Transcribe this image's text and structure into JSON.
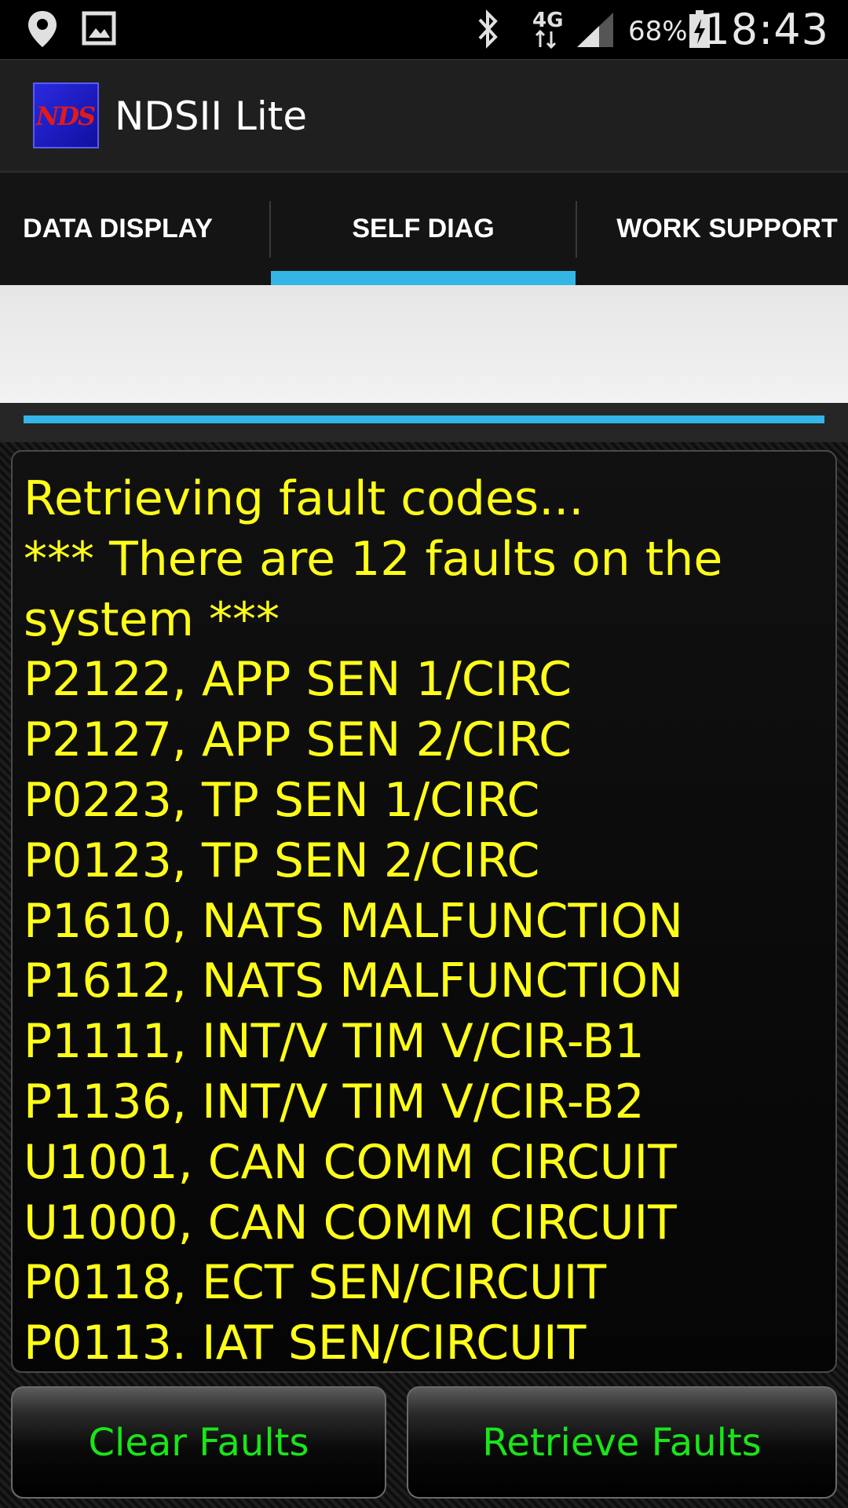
{
  "status_bar": {
    "time": "18:43",
    "battery_percent": "68%",
    "network_type": "4G",
    "icons": [
      "location-pin-icon",
      "image-icon",
      "bluetooth-icon",
      "network-4g-icon",
      "signal-icon",
      "battery-charging-icon"
    ]
  },
  "app": {
    "title": "NDSII Lite",
    "logo_text": "NDS"
  },
  "tabs": [
    {
      "label": "DATA DISPLAY",
      "selected": false
    },
    {
      "label": "SELF DIAG",
      "selected": true
    },
    {
      "label": "WORK SUPPORT",
      "selected": false
    }
  ],
  "progress": {
    "fraction": 1.0
  },
  "output": {
    "lines": [
      "Retrieving fault codes...",
      "*** There are 12 faults on the",
      "system ***",
      "P2122, APP SEN 1/CIRC",
      "P2127, APP SEN 2/CIRC",
      "P0223, TP SEN 1/CIRC",
      "P0123, TP SEN 2/CIRC",
      "P1610, NATS MALFUNCTION",
      "P1612, NATS MALFUNCTION",
      "P1111, INT/V TIM V/CIR-B1",
      "P1136, INT/V TIM V/CIR-B2",
      "U1001, CAN COMM CIRCUIT",
      "U1000, CAN COMM CIRCUIT",
      "P0118, ECT SEN/CIRCUIT",
      "P0113. IAT SEN/CIRCUIT"
    ]
  },
  "buttons": {
    "clear_label": "Clear Faults",
    "retrieve_label": "Retrieve Faults"
  },
  "colors": {
    "accent": "#33b5e5",
    "output_text": "#ffff19",
    "button_text": "#19e619"
  }
}
